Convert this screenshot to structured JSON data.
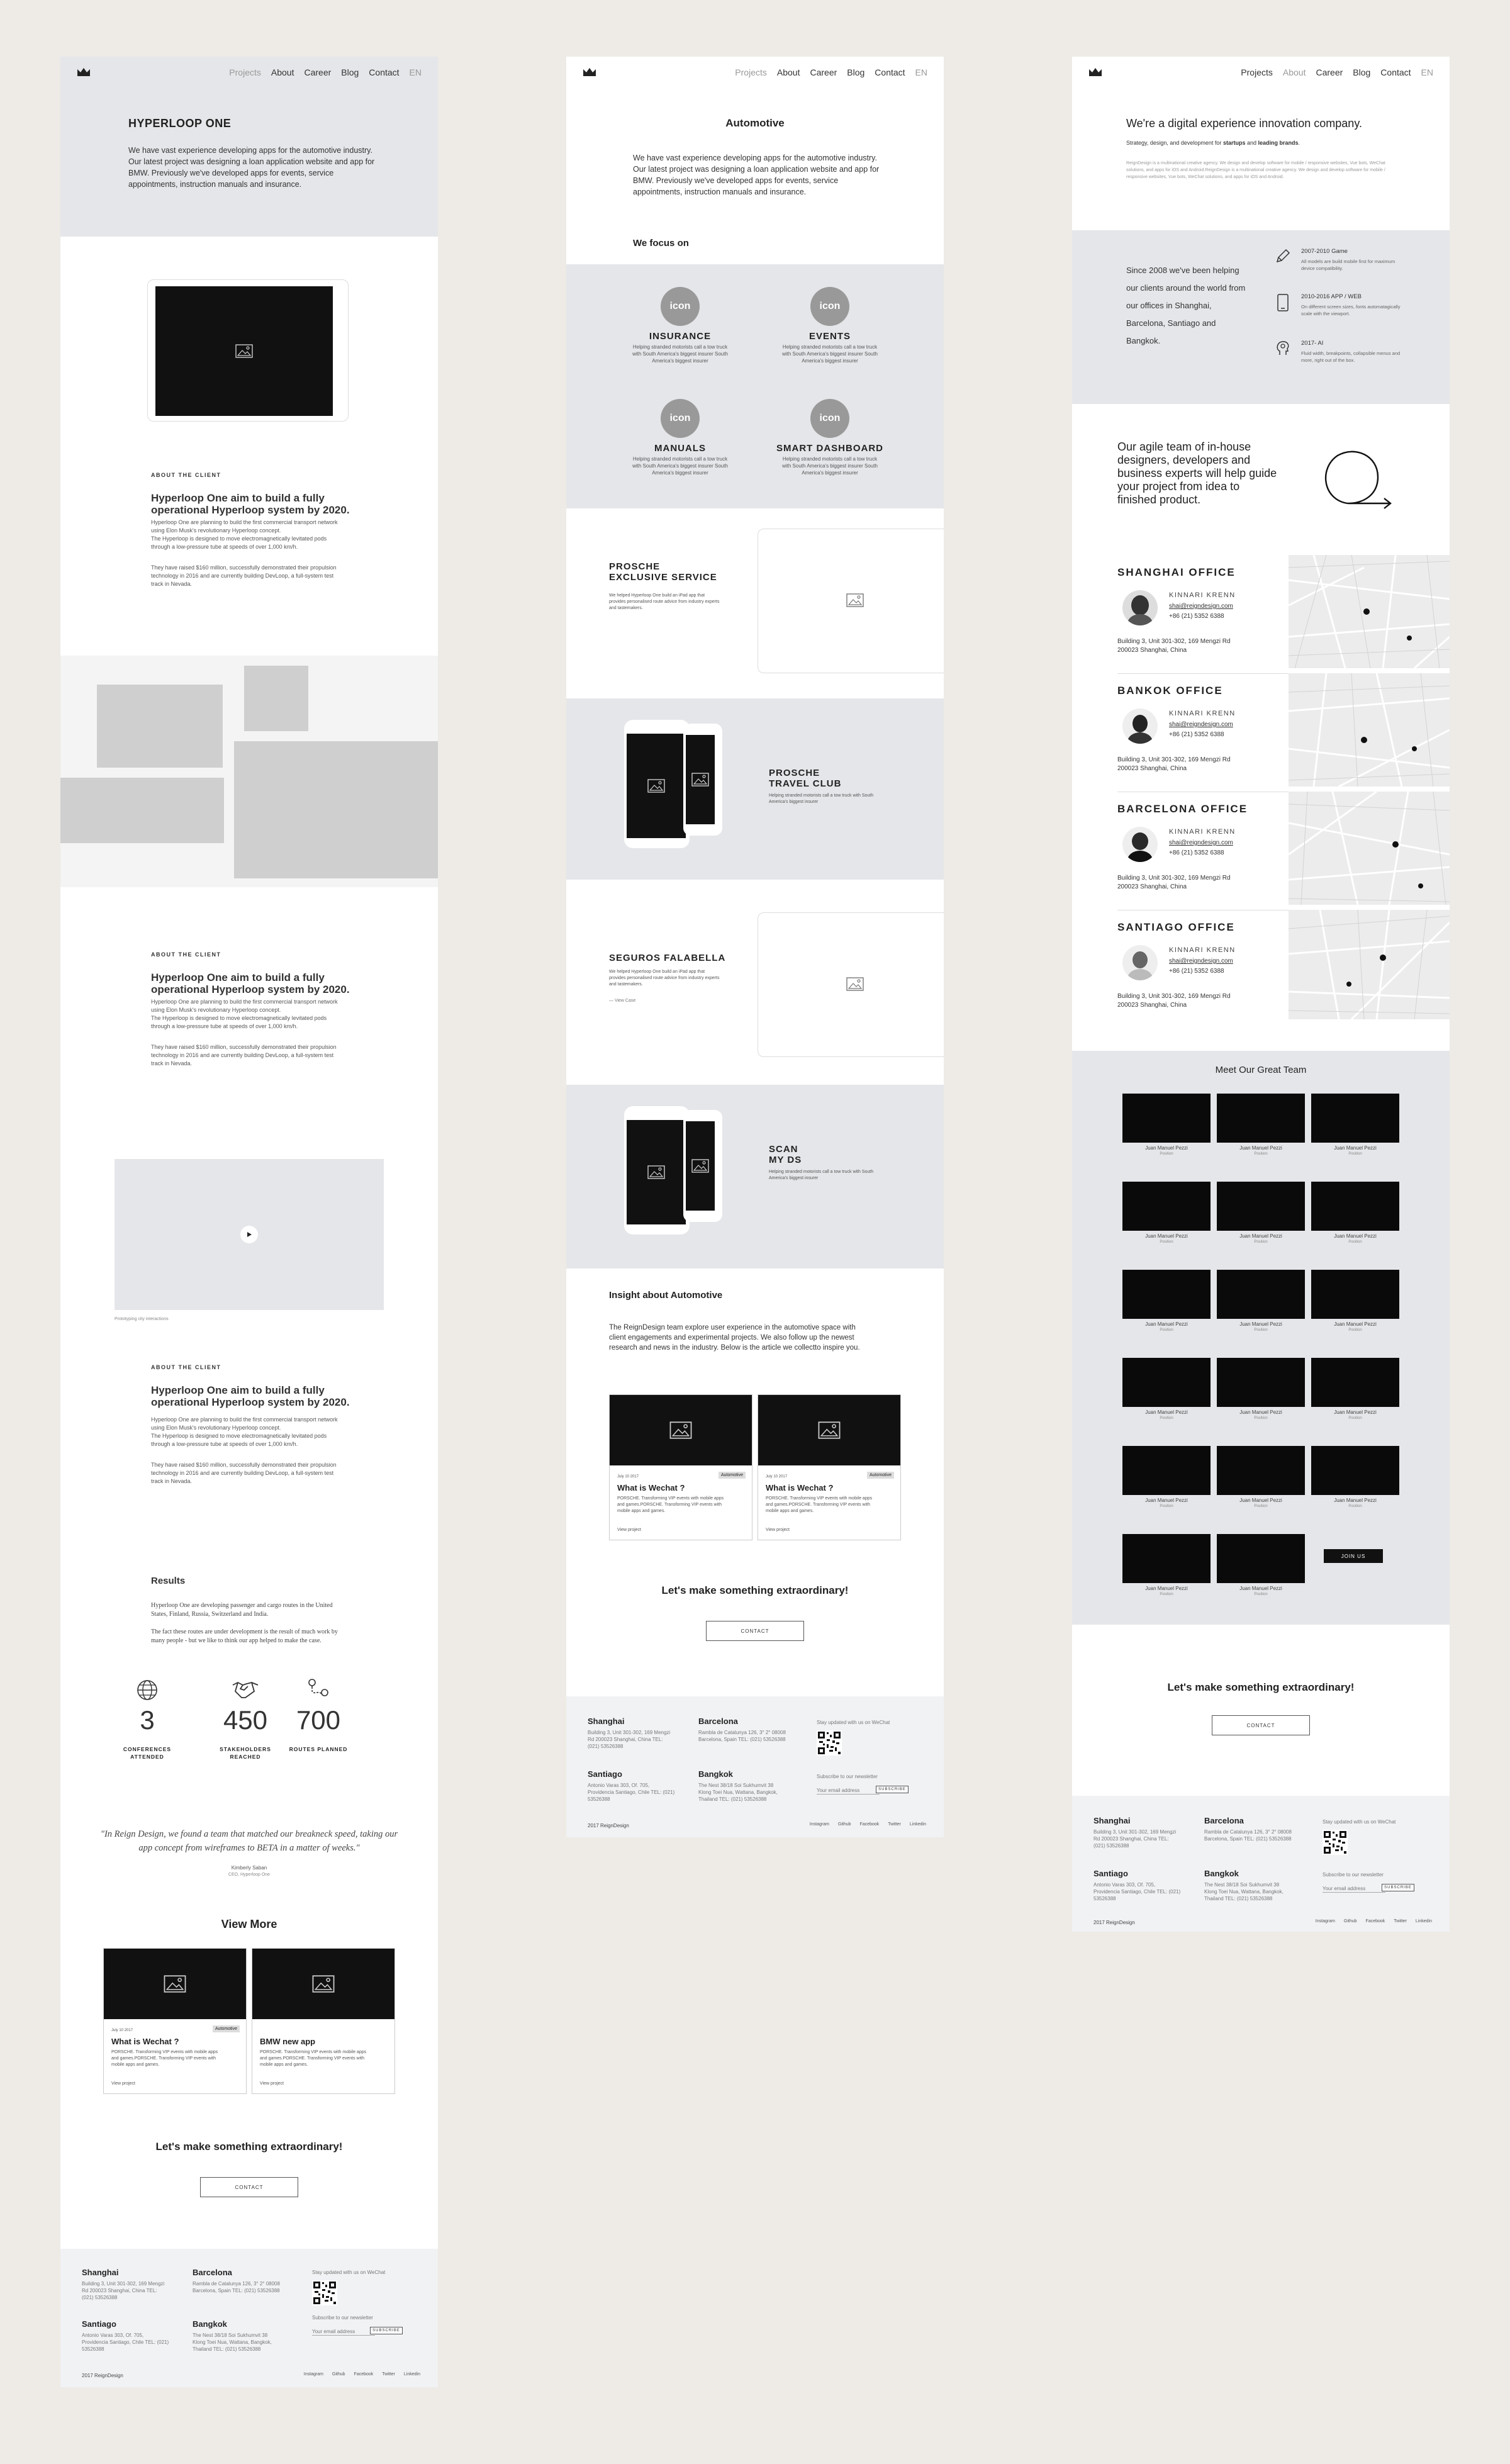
{
  "nav": {
    "projects": "Projects",
    "about": "About",
    "career": "Career",
    "blog": "Blog",
    "contact": "Contact",
    "lang": "EN"
  },
  "icons": {
    "logo": "crown-icon",
    "image": "image-placeholder-icon",
    "play": "play-icon",
    "globe": "globe-icon",
    "handshake": "handshake-icon",
    "routes": "route-icon",
    "pencil": "pencil-icon",
    "phone": "phone-icon",
    "ai": "ai-head-icon",
    "loop": "loop-arrow-icon",
    "pin": "map-pin-icon",
    "qr": "qr-code-icon"
  },
  "colors": {
    "page_bg": "#eeebe6",
    "grey_panel": "#e5e6e9",
    "dark": "#111111",
    "footer_bg": "#f1f2f4"
  },
  "c1": {
    "hero": {
      "title": "HYPERLOOP ONE",
      "text": "We have vast experience developing apps for the automotive industry. Our latest project was designing a loan application website and app for BMW. Previously we've developed apps for events, service appointments, instruction manuals and insurance."
    },
    "about1": {
      "label": "ABOUT THE CLIENT",
      "title": "Hyperloop One aim to build a fully operational Hyperloop system by 2020.",
      "p1": "Hyperloop One are planning to build the first commercial transport network using Elon Musk's revolutionary Hyperloop concept.",
      "p2": "The Hyperloop is designed to move electromagnetically levitated pods through a low-pressure tube at speeds of over 1,000 km/h.",
      "p3": "They have raised $160 million, successfully demonstrated their propulsion technology in 2016 and are currently building DevLoop, a full-system test track in Nevada."
    },
    "about2": {
      "label": "ABOUT THE CLIENT",
      "title": "Hyperloop One aim to build a fully operational Hyperloop system by 2020.",
      "p1": "Hyperloop One are planning to build the first commercial transport network using Elon Musk's revolutionary Hyperloop concept.",
      "p2": "The Hyperloop is designed to move electromagnetically levitated pods through a low-pressure tube at speeds of over 1,000 km/h.",
      "p3": "They have raised $160 million, successfully demonstrated their propulsion technology in 2016 and are currently building DevLoop, a full-system test track in Nevada."
    },
    "video_caption": "Prototyping city interactions",
    "about3": {
      "label": "ABOUT THE CLIENT",
      "title": "Hyperloop One aim to build a fully operational Hyperloop system by 2020.",
      "p1": "Hyperloop One are planning to build the first commercial transport network using Elon Musk's revolutionary Hyperloop concept.",
      "p2": "The Hyperloop is designed to move electromagnetically levitated pods through a low-pressure tube at speeds of over 1,000 km/h.",
      "p3": "They have raised $160 million, successfully demonstrated their propulsion technology in 2016 and are currently building DevLoop, a full-system test track in Nevada."
    },
    "results": {
      "title": "Results",
      "p1": "Hyperloop One are developing passenger and cargo routes in the United States, Finland, Russia, Switzerland and India.",
      "p2": "The fact these routes are under development is the result of much work by many people - but we like to think our app helped to make the case.",
      "stats": [
        {
          "value": "3",
          "label": "CONFERENCES ATTENDED"
        },
        {
          "value": "450",
          "label": "STAKEHOLDERS REACHED"
        },
        {
          "value": "700",
          "label": "ROUTES PLANNED"
        }
      ]
    },
    "quote": {
      "text": "\"In Reign Design, we found a team that matched our breakneck speed, taking our app concept from wireframes to BETA in a matter of weeks.\"",
      "author": "Kimberly Saban",
      "role": "CEO, Hyperloop One"
    },
    "view_more": "View More",
    "cards": [
      {
        "date": "July 10 2017",
        "badge": "Automotive",
        "title": "What is Wechat ?",
        "text": "PORSCHE. Transforming VIP events with mobile apps and games.PORSCHE. Transforming VIP events with mobile apps and games.",
        "link": "View project"
      },
      {
        "date": "",
        "badge": "",
        "title": "BMW new app",
        "text": "PORSCHE. Transforming VIP events with mobile apps and games.PORSCHE. Transforming VIP events with mobile apps and games.",
        "link": "View project"
      }
    ],
    "cta": "Let's make something extraordinary!",
    "contact": "CONTACT"
  },
  "c2": {
    "hero": {
      "title": "Automotive",
      "text": "We have vast experience developing apps for the automotive industry. Our latest project was designing a loan application website and app for BMW. Previously we've developed apps for events, service appointments, instruction manuals and insurance."
    },
    "focus": "We focus on",
    "services": [
      {
        "icon": "icon",
        "title": "INSURANCE",
        "text": "Helping stranded motorists call a tow truck with South America's biggest insurer South America's biggest insurer"
      },
      {
        "icon": "icon",
        "title": "EVENTS",
        "text": "Helping stranded motorists call a tow truck with South America's biggest insurer South America's biggest insurer"
      },
      {
        "icon": "icon",
        "title": "MANUALS",
        "text": "Helping stranded motorists call a tow truck with South America's biggest insurer South America's biggest insurer"
      },
      {
        "icon": "icon",
        "title": "SMART DASHBOARD",
        "text": "Helping stranded motorists call a tow truck with South America's biggest insurer South America's biggest insurer"
      }
    ],
    "projects": [
      {
        "title": "PROSCHE\nEXCLUSIVE SERVICE",
        "text": "We helped Hyperloop One build an iPad app that provides personalised route advice from industry experts and tastemakers.",
        "link": ""
      },
      {
        "title": "PROSCHE\nTRAVEL CLUB",
        "text": "Helping stranded motorists call a tow truck with South America's biggest insurer",
        "link": ""
      },
      {
        "title": "SEGUROS FALABELLA",
        "text": "We helped Hyperloop One build an iPad app that provides personalised route advice from industry experts and tastemakers.",
        "link": "— View Case"
      },
      {
        "title": "SCAN\nMY DS",
        "text": "Helping stranded motorists call a tow truck with South America's biggest insurer",
        "link": ""
      }
    ],
    "insight": {
      "title": "Insight about Automotive",
      "text": "The ReignDesign team explore user experience in the automotive space with client engagements and experimental projects. We also follow up the newest research and news in the industry. Below is the article we collectto inspire you."
    },
    "cards": [
      {
        "date": "July 10 2017",
        "badge": "Automotive",
        "title": "What is Wechat ?",
        "text": "PORSCHE. Transforming VIP events with mobile apps and games.PORSCHE. Transforming VIP events with mobile apps and games.",
        "link": "View project"
      },
      {
        "date": "July 10 2017",
        "badge": "Automotive",
        "title": "What is Wechat ?",
        "text": "PORSCHE. Transforming VIP events with mobile apps and games.PORSCHE. Transforming VIP events with mobile apps and games.",
        "link": "View project"
      }
    ],
    "cta": "Let's make something extraordinary!",
    "contact": "CONTACT"
  },
  "c3": {
    "hero": {
      "title": "We're a digital experience innovation company.",
      "sub_pre": "Strategy, design, and development for ",
      "sub_b1": "startups",
      "sub_mid": " and ",
      "sub_b2": "leading brands",
      "sub_end": ".",
      "text": "ReignDesign is a multinational creative agency. We design and develop software for mobile / responsive websites, Vue bots, WeChat solutions, and apps for iOS and Android.ReignDesign is a multinational creative agency. We design and develop software for mobile / responsive websites, Vue bots, WeChat solutions, and apps for iOS and Android."
    },
    "since": "Since 2008 we've been helping our clients around the world from our offices in Shanghai, Barcelona, Santiago and Bangkok.",
    "timeline": [
      {
        "title": "2007-2010 Game",
        "text": "All models are build mobile first for maximum device compatibility."
      },
      {
        "title": "2010-2016 APP / WEB",
        "text": "On different screen sizes, fonts automatagically scale with the viewport."
      },
      {
        "title": "2017- AI",
        "text": "Fluid width, breakpoints, collapsible menus and more, right out of the box."
      }
    ],
    "agile": "Our agile team of in-house designers, developers and business experts will help guide your project from idea to finished product.",
    "offices": [
      {
        "title": "SHANGHAI OFFICE",
        "name": "KINNARI KRENN",
        "email": "shai@reigndesign.com",
        "phone": "+86 (21) 5352 6388",
        "addr1": "Building 3, Unit 301-302, 169 Mengzi Rd",
        "addr2": "200023 Shanghai, China"
      },
      {
        "title": "BANKOK OFFICE",
        "name": "KINNARI KRENN",
        "email": "shai@reigndesign.com",
        "phone": "+86 (21) 5352 6388",
        "addr1": "Building 3, Unit 301-302, 169 Mengzi Rd",
        "addr2": "200023 Shanghai, China"
      },
      {
        "title": "BARCELONA OFFICE",
        "name": "KINNARI KRENN",
        "email": "shai@reigndesign.com",
        "phone": "+86 (21) 5352 6388",
        "addr1": "Building 3, Unit 301-302, 169 Mengzi Rd",
        "addr2": "200023 Shanghai, China"
      },
      {
        "title": "SANTIAGO OFFICE",
        "name": "KINNARI KRENN",
        "email": "shai@reigndesign.com",
        "phone": "+86 (21) 5352 6388",
        "addr1": "Building 3, Unit 301-302, 169 Mengzi Rd",
        "addr2": "200023 Shanghai, China"
      }
    ],
    "team_title": "Meet Our Great Team",
    "member": {
      "name": "Juan Manuel Pezzi",
      "role": "Position"
    },
    "join": "JOIN US",
    "cta": "Let's make something extraordinary!",
    "contact": "CONTACT"
  },
  "footer": {
    "shanghai": "Shanghai",
    "shanghai_addr": "Building 3, Unit 301-302, 169 Mengzi Rd 200023 Shanghai, China TEL: (021) 53526388",
    "barcelona": "Barcelona",
    "barcelona_addr": "Rambla de Catalunya 126, 3° 2° 08008 Barcelona, Spain TEL: (021) 53526388",
    "santiago": "Santiago",
    "santiago_addr": "Antonio Varas 303, Of. 705, Providencia Santiago, Chile TEL: (021) 53526388",
    "bangkok": "Bangkok",
    "bangkok_addr": "The Nest 38/18 Soi Sukhumvit 38 Klong Toei Nua, Wattana, Bangkok, Thailand TEL: (021) 53526388",
    "wechat": "Stay updated with us on WeChat",
    "newsletter": "Subscribe to our newsletter",
    "email_ph": "Your email address",
    "subscribe": "SUBSCRIBE",
    "copyright": "2017 ReignDesign",
    "links": [
      "Instagram",
      "Github",
      "Facebook",
      "Twitter",
      "Linkedin"
    ]
  }
}
